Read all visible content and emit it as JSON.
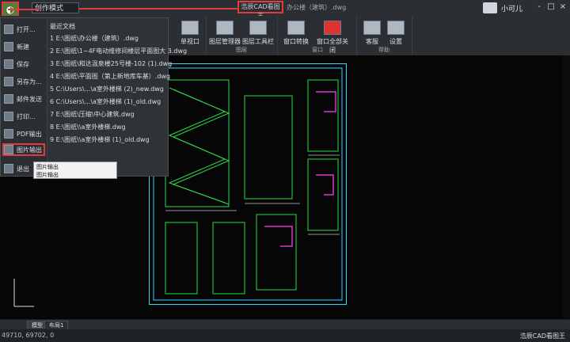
{
  "titlebar": {
    "search_input_value": "创作模式",
    "app_title": "浩辰CAD看图王",
    "file_title": "办公楼（建筑）.dwg",
    "username": "小可儿",
    "window_controls": [
      "-",
      "□",
      "×"
    ]
  },
  "ribbon": {
    "groups": [
      {
        "label": "",
        "buttons": [
          {
            "label": "单视口",
            "icon": "single-viewport-icon"
          }
        ]
      },
      {
        "label": "图层",
        "buttons": [
          {
            "label": "图层管理器",
            "icon": "layer-manager-icon"
          },
          {
            "label": "图层工具栏",
            "icon": "layer-toolbar-icon"
          }
        ]
      },
      {
        "label": "窗口",
        "buttons": [
          {
            "label": "窗口转换",
            "icon": "window-switch-icon"
          },
          {
            "label": "窗口全部关闭",
            "icon": "close-all-windows-icon"
          }
        ]
      },
      {
        "label": "帮助",
        "buttons": [
          {
            "label": "客服",
            "icon": "support-icon"
          },
          {
            "label": "设置",
            "icon": "settings-icon"
          }
        ]
      }
    ]
  },
  "app_menu": {
    "left_items": [
      {
        "label": "打开...",
        "icon": "open-icon"
      },
      {
        "label": "新建",
        "icon": "new-icon"
      },
      {
        "label": "保存",
        "icon": "save-icon"
      },
      {
        "label": "另存为...",
        "icon": "save-as-icon"
      },
      {
        "label": "邮件发送",
        "icon": "mail-icon"
      },
      {
        "label": "打印...",
        "icon": "print-icon"
      },
      {
        "label": "PDF输出",
        "icon": "pdf-icon"
      },
      {
        "label": "图片输出",
        "icon": "image-export-icon"
      },
      {
        "label": "退出",
        "icon": "exit-icon"
      }
    ],
    "recent_title": "最近文档",
    "recent_files": [
      "1 E:\\图纸\\办公楼（建筑）.dwg",
      "2 E:\\图纸\\1~4F电动维修间楼层平面图大 3.dwg",
      "3 E:\\图纸\\和达温泉楼25号楼-102 (1).dwg",
      "4 E:\\图纸\\平面图（第上新地库车基）.dwg",
      "5 C:\\Users\\...\\a室外楼梯 (2)_new.dwg",
      "6 C:\\Users\\...\\a室外楼梯 (1)_old.dwg",
      "7 E:\\图纸\\压缩\\中心建筑.dwg",
      "8 E:\\图纸\\\\a室外楼梯.dwg",
      "9 E:\\图纸\\\\a室外楼梯 (1)_old.dwg"
    ],
    "tooltip_title": "图片输出",
    "tooltip_desc": "图片输出"
  },
  "tabs": {
    "model_label": "模型",
    "layout_label": "布局1"
  },
  "status": {
    "coords": "49710, 69702, 0",
    "right_text": "浩辰CAD看图王"
  },
  "colors": {
    "accent_red": "#e23b3b",
    "app_green": "#4f7f3b",
    "cad_line_cyan": "#35d7ff",
    "cad_line_green": "#2ee84c",
    "cad_line_magenta": "#e93ad9"
  }
}
